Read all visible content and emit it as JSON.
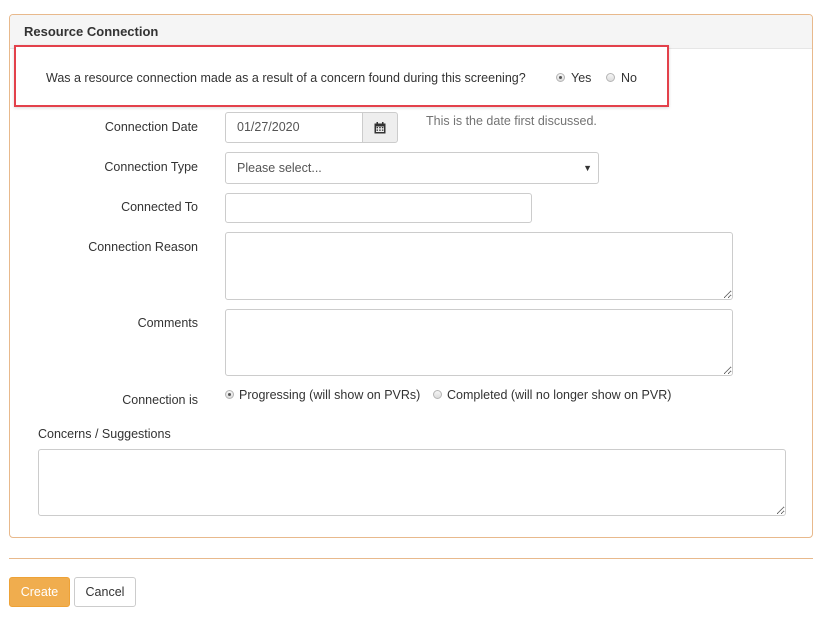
{
  "panel": {
    "title": "Resource Connection"
  },
  "question": {
    "text": "Was a resource connection made as a result of a concern found during this screening?",
    "yes_label": "Yes",
    "no_label": "No",
    "selected": "Yes"
  },
  "form": {
    "connection_date_label": "Connection Date",
    "connection_date_value": "01/27/2020",
    "connection_date_help": "This is the date first discussed.",
    "connection_type_label": "Connection Type",
    "connection_type_value": "Please select...",
    "connected_to_label": "Connected To",
    "connected_to_value": "",
    "connection_reason_label": "Connection Reason",
    "connection_reason_value": "",
    "comments_label": "Comments",
    "comments_value": "",
    "connection_is_label": "Connection is",
    "progressing_label": "Progressing (will show on PVRs)",
    "completed_label": "Completed (will no longer show on PVR)",
    "connection_is_selected": "Progressing",
    "concerns_label": "Concerns / Suggestions",
    "concerns_value": ""
  },
  "actions": {
    "create_label": "Create",
    "cancel_label": "Cancel"
  },
  "icons": {
    "calendar": "calendar-icon",
    "caret": "chevron-down-icon"
  },
  "colors": {
    "accent": "#f0ad4e",
    "panel_border": "#e8b98c",
    "highlight": "#e3414b"
  }
}
